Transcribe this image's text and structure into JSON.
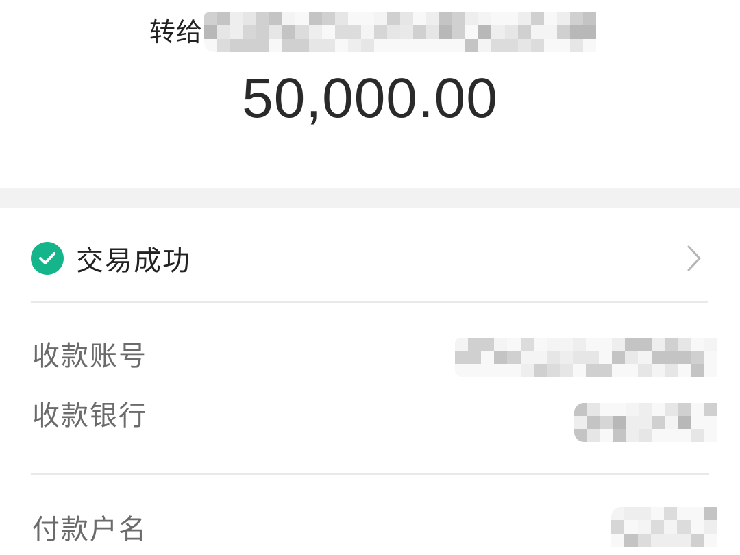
{
  "header": {
    "transfer_prefix": "转给",
    "recipient_name": ""
  },
  "amount": "50,000.00",
  "status": {
    "label": "交易成功",
    "icon": "check-circle-icon",
    "color": "#14b58a"
  },
  "details": {
    "receiving_account": {
      "label": "收款账号",
      "value": ""
    },
    "receiving_bank": {
      "label": "收款银行",
      "value": ""
    },
    "payer_name": {
      "label": "付款户名",
      "value": ""
    }
  },
  "colors": {
    "text_primary": "#222222",
    "text_secondary": "#6b6b6b",
    "success_green": "#14b58a",
    "band_gray": "#f2f2f2"
  }
}
